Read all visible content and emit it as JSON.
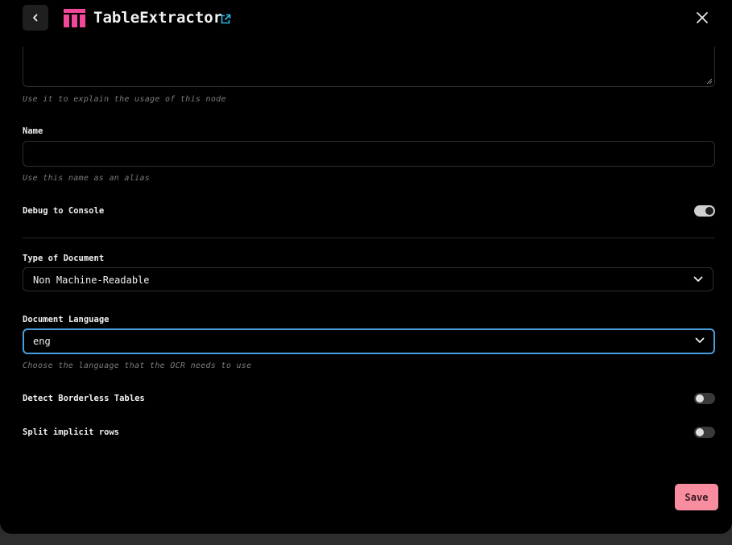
{
  "header": {
    "title": "TableExtractor",
    "back_icon": "chevron-left-icon",
    "logo_icon": "table-logo-icon",
    "external_icon": "external-link-icon",
    "close_icon": "close-icon",
    "logo_color": "#f2489a",
    "external_color": "#29b6e8"
  },
  "description": {
    "value": "",
    "hint": "Use it to explain the usage of this node"
  },
  "name_field": {
    "label": "Name",
    "value": "",
    "hint": "Use this name as an alias"
  },
  "debug": {
    "label": "Debug to Console",
    "enabled": true
  },
  "document_type": {
    "label": "Type of Document",
    "selected": "Non Machine-Readable"
  },
  "language": {
    "label": "Document Language",
    "selected": "eng",
    "hint": "Choose the language that the OCR needs to use",
    "focus_color": "#4a9edd"
  },
  "borderless": {
    "label": "Detect Borderless Tables",
    "enabled": false
  },
  "split_rows": {
    "label": "Split implicit rows",
    "enabled": false
  },
  "footer": {
    "save_label": "Save",
    "save_color": "#f98da0"
  }
}
